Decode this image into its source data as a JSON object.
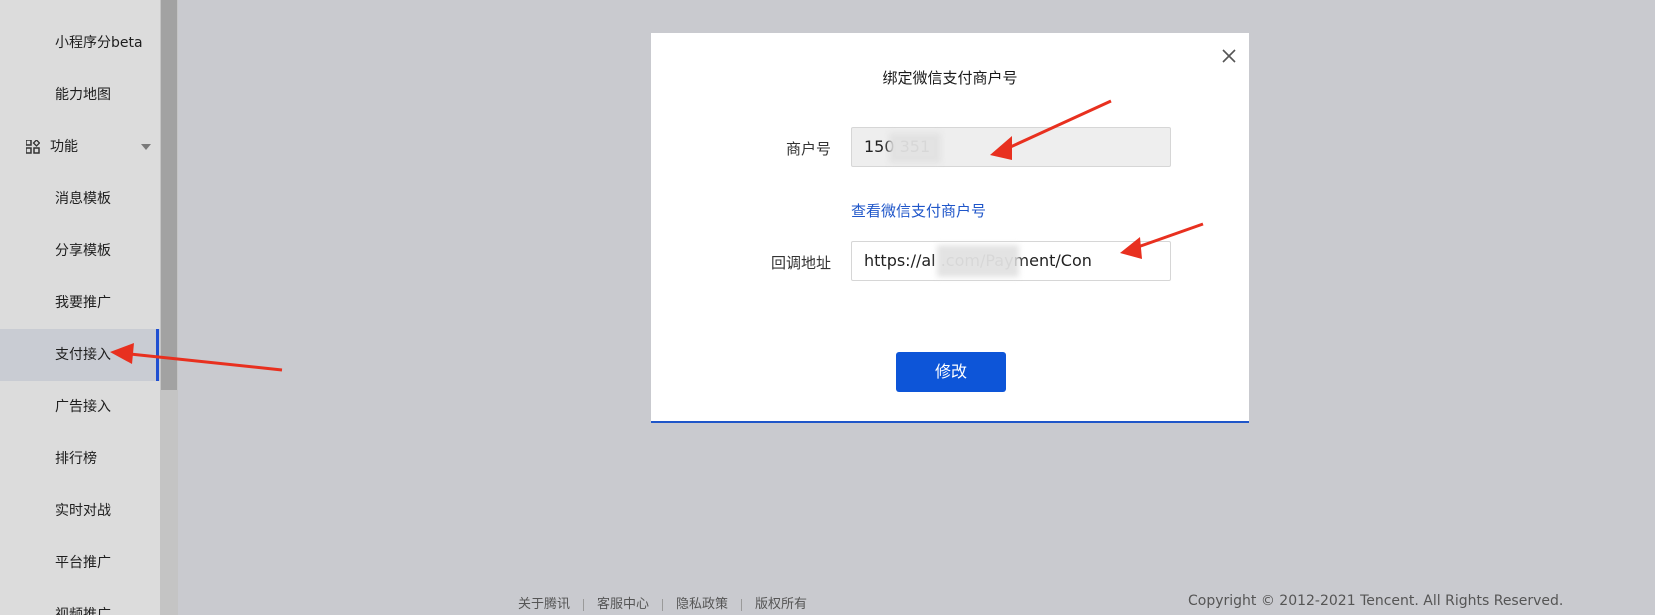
{
  "sidebar": {
    "items": [
      {
        "label": "小程序分beta"
      },
      {
        "label": "能力地图"
      },
      {
        "label": "功能"
      },
      {
        "label": "消息模板"
      },
      {
        "label": "分享模板"
      },
      {
        "label": "我要推广"
      },
      {
        "label": "支付接入"
      },
      {
        "label": "广告接入"
      },
      {
        "label": "排行榜"
      },
      {
        "label": "实时对战"
      },
      {
        "label": "平台推广"
      },
      {
        "label": "视频推广"
      }
    ],
    "active_item": "支付接入"
  },
  "modal": {
    "title": "绑定微信支付商户号",
    "merchant_label": "商户号",
    "merchant_value": "150      351",
    "view_link": "查看微信支付商户号",
    "callback_label": "回调地址",
    "callback_value": "https://al          .com/Payment/Con",
    "submit_label": "修改",
    "close_icon": "close-icon"
  },
  "footer": {
    "links": [
      "关于腾讯",
      "客服中心",
      "隐私政策",
      "版权所有"
    ],
    "copyright": "Copyright © 2012-2021 Tencent. All Rights Reserved."
  },
  "colors": {
    "accent": "#0d55d8",
    "link": "#1f56c9",
    "arrow": "#e8301f"
  }
}
